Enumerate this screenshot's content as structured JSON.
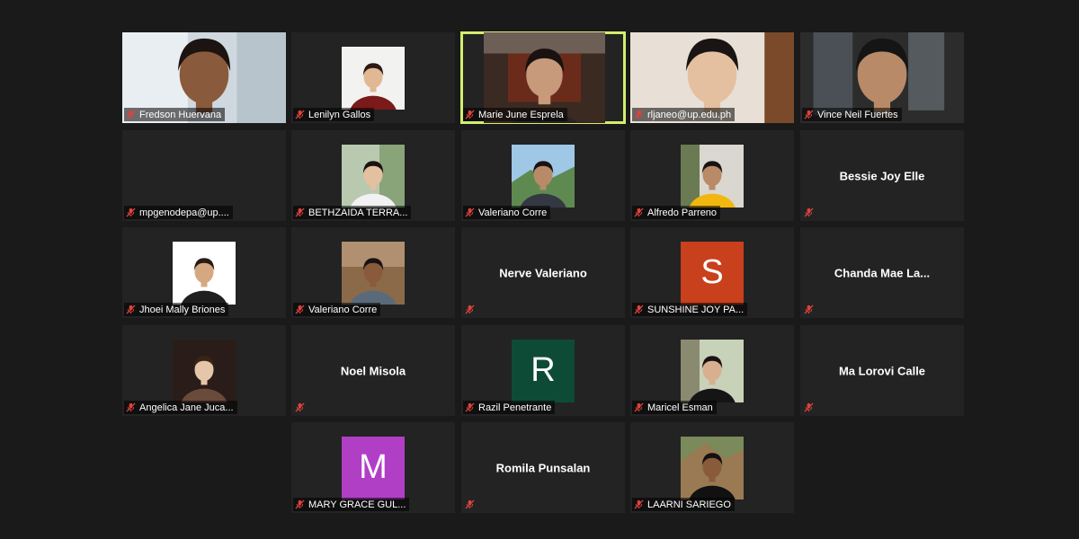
{
  "accent_colors": {
    "active_speaker": "#d3ee6e",
    "muted_icon": "#e0433a"
  },
  "participants": [
    {
      "name": "Fredson Huervana",
      "video": "fredson"
    },
    {
      "name": "Lenilyn Gallos",
      "video": "lenilyn"
    },
    {
      "name": "Marie June Esprela",
      "video": "marie",
      "active": true
    },
    {
      "name": "rljaneo@up.edu.ph",
      "video": "rljaneo"
    },
    {
      "name": "Vince Neil Fuertes",
      "video": "vince"
    },
    {
      "name": "mpgenodepa@up....",
      "video": "none"
    },
    {
      "name": "BETHZAIDA TERRA...",
      "video": "bethzaida"
    },
    {
      "name": "Valeriano Corre",
      "video": "valeriano1"
    },
    {
      "name": "Alfredo Parreno",
      "video": "alfredo"
    },
    {
      "name": "",
      "center": "Bessie Joy Elle"
    },
    {
      "name": "Jhoei Mally Briones",
      "video": "jhoei"
    },
    {
      "name": "Valeriano Corre",
      "video": "valeriano2"
    },
    {
      "name": "",
      "center": "Nerve Valeriano"
    },
    {
      "name": "SUNSHINE JOY PA...",
      "avatar": "S",
      "avatar_color": "#c8401c"
    },
    {
      "name": "",
      "center": "Chanda  Mae  La..."
    },
    {
      "name": "Angelica Jane Juca...",
      "video": "angelica"
    },
    {
      "name": "",
      "center": "Noel Misola"
    },
    {
      "name": "Razil Penetrante",
      "avatar": "R",
      "avatar_color": "#0e4b37"
    },
    {
      "name": "Maricel Esman",
      "video": "maricel"
    },
    {
      "name": "",
      "center": "Ma Lorovi Calle"
    },
    {
      "name": "MARY GRACE GUL...",
      "avatar": "M",
      "avatar_color": "#b13fc6"
    },
    {
      "name": "",
      "center": "Romila Punsalan"
    },
    {
      "name": "LAARNI SARIEGO",
      "video": "laarni"
    }
  ]
}
